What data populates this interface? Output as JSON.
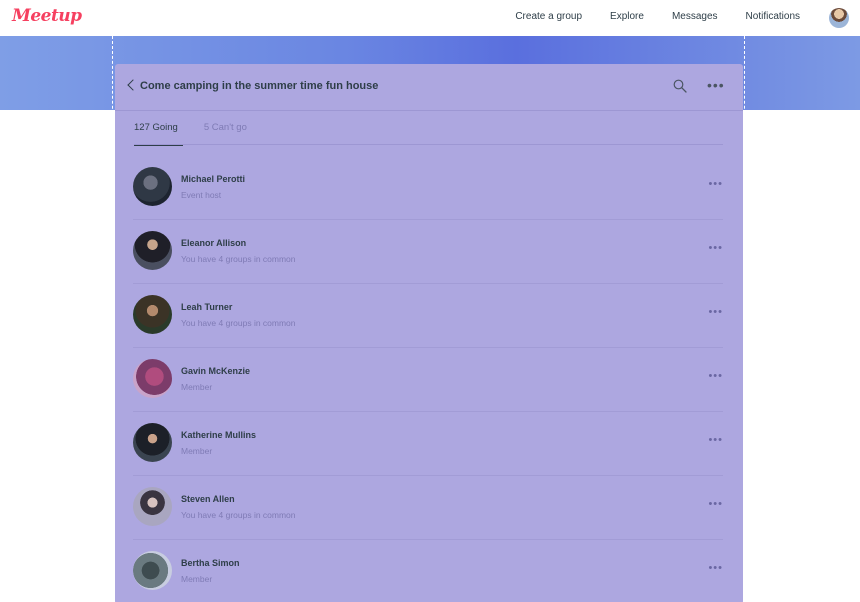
{
  "nav": {
    "logo": "Meetup",
    "links": [
      "Create a group",
      "Explore",
      "Messages",
      "Notifications"
    ]
  },
  "header": {
    "title": "Come camping in the summer time fun house",
    "back_icon": "chevron-left-icon",
    "search_icon": "search-icon",
    "more_icon": "more-horizontal-icon"
  },
  "tabs": [
    {
      "label": "127 Going",
      "active": true
    },
    {
      "label": "5 Can't go",
      "active": false
    }
  ],
  "attendees": [
    {
      "name": "Michael Perotti",
      "subtitle": "Event host",
      "avatar_color": "#3d4a5a"
    },
    {
      "name": "Eleanor Allison",
      "subtitle": "You have 4 groups in common",
      "avatar_color": "#2e3340"
    },
    {
      "name": "Leah Turner",
      "subtitle": "You have 4 groups in common",
      "avatar_color": "#4a3d2e"
    },
    {
      "name": "Gavin McKenzie",
      "subtitle": "Member",
      "avatar_color": "#8a4a6e"
    },
    {
      "name": "Katherine Mullins",
      "subtitle": "Member",
      "avatar_color": "#2e3640"
    },
    {
      "name": "Steven Allen",
      "subtitle": "You have 4 groups in common",
      "avatar_color": "#8a8aa8"
    },
    {
      "name": "Bertha Simon",
      "subtitle": "Member",
      "avatar_color": "#5a6a70"
    }
  ],
  "colors": {
    "brand": "#f64060",
    "card_overlay": "#ada7e0",
    "hero": "#6a86e2",
    "text_dark": "#2e3e48"
  }
}
